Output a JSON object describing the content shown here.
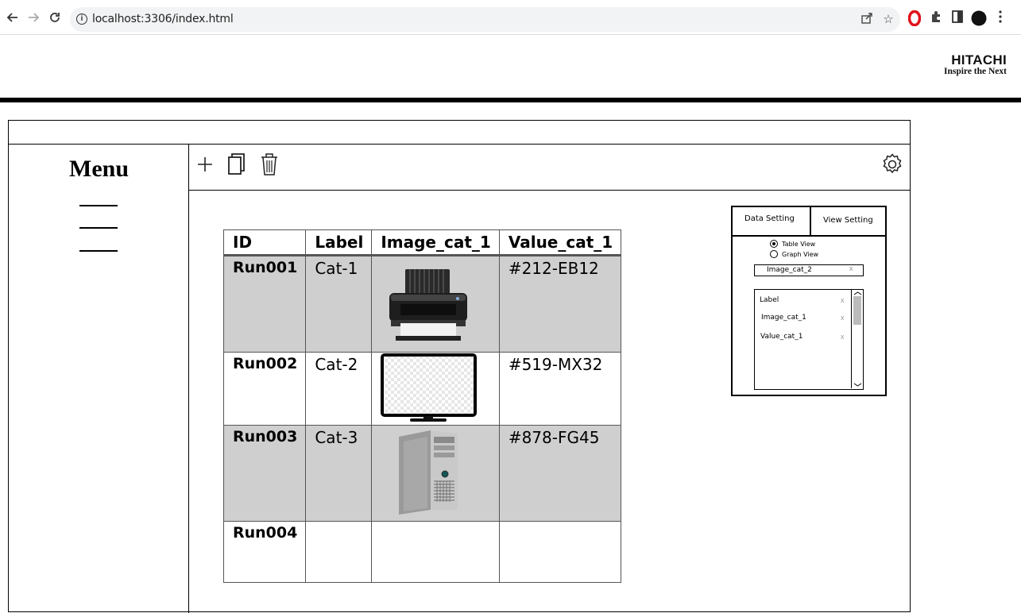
{
  "browser": {
    "url": "localhost:3306/index.html",
    "icons": [
      "back-icon",
      "forward-icon",
      "reload-icon",
      "info-icon",
      "share-icon",
      "bookmark-star-icon",
      "opera-icon",
      "extensions-icon",
      "sidepanel-icon",
      "profile-icon",
      "kebab-menu-icon"
    ]
  },
  "header": {
    "brand": "HITACHI",
    "tagline": "Inspire the Next"
  },
  "sidebar": {
    "title": "Menu"
  },
  "toolbar": {
    "icons": [
      "add-icon",
      "copy-icon",
      "delete-icon",
      "settings-icon"
    ]
  },
  "table": {
    "columns": [
      "ID",
      "Label",
      "Image_cat_1",
      "Value_cat_1"
    ],
    "rows": [
      {
        "id": "Run001",
        "label": "Cat-1",
        "image": "printer",
        "value": "#212-EB12"
      },
      {
        "id": "Run002",
        "label": "Cat-2",
        "image": "monitor",
        "value": "#519-MX32"
      },
      {
        "id": "Run003",
        "label": "Cat-3",
        "image": "desktop-tower",
        "value": "#878-FG45"
      },
      {
        "id": "Run004",
        "label": "",
        "image": "",
        "value": ""
      }
    ]
  },
  "settings_panel": {
    "tabs": [
      "Data Setting",
      "View Setting"
    ],
    "view_options": [
      "Table View",
      "Graph View"
    ],
    "selected_view": "Table View",
    "field_value": "Image_cat_2",
    "remove_glyph": "x",
    "list_items": [
      "Label",
      "Image_cat_1",
      "Value_cat_1"
    ]
  },
  "colors": {
    "shaded_row": "#cfcfcf",
    "header_bar": "#000000",
    "opera_red": "#e0121b"
  }
}
